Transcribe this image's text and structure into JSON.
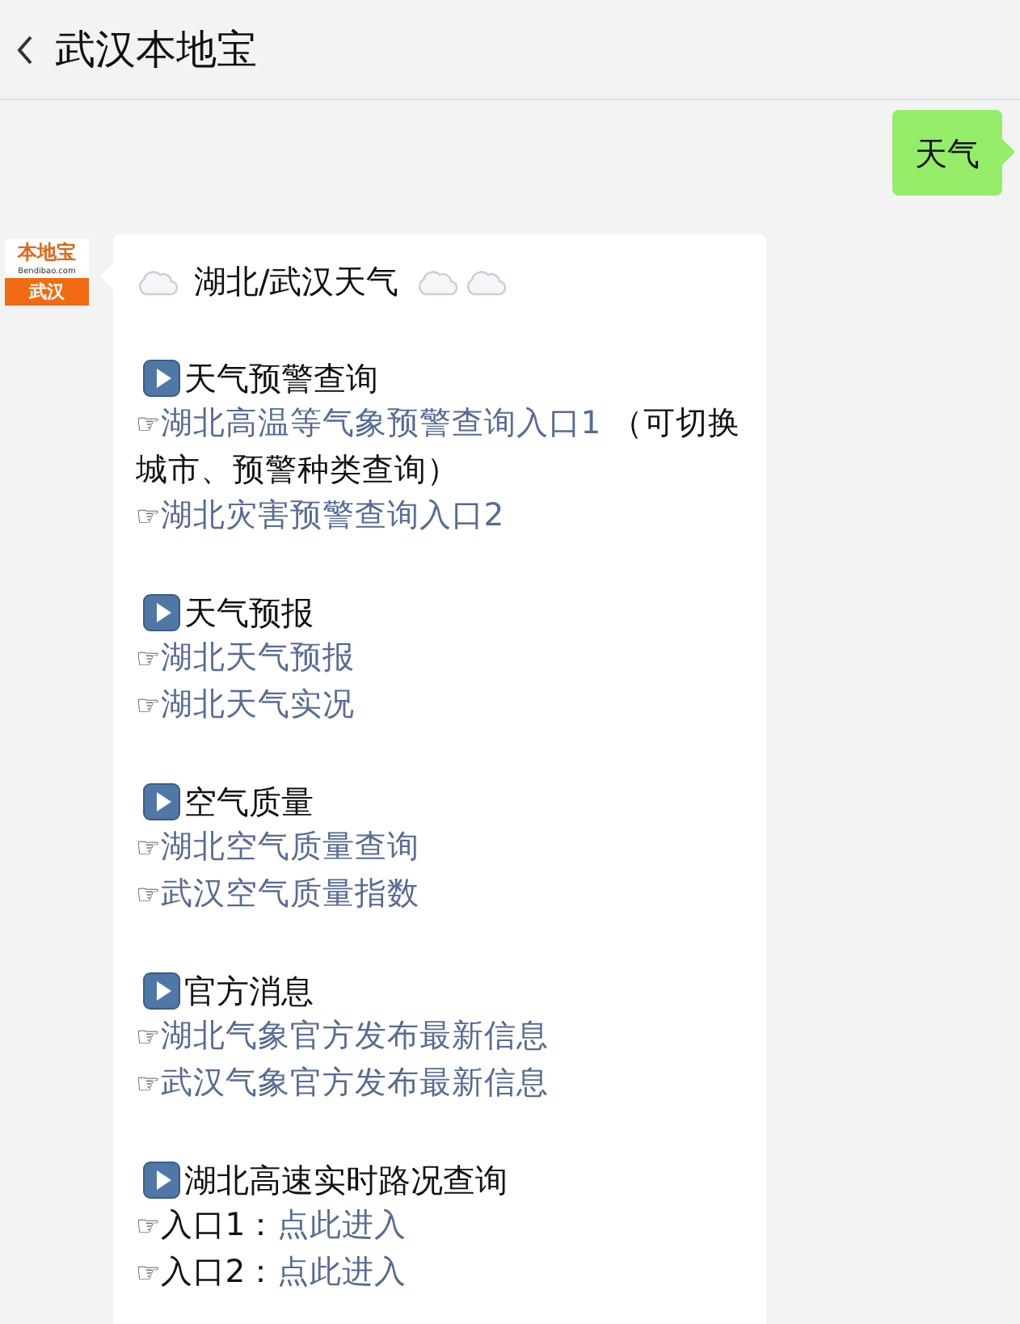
{
  "header": {
    "title": "武汉本地宝"
  },
  "messages": [
    {
      "kind": "sent",
      "text": "天气"
    },
    {
      "kind": "received",
      "avatar": {
        "brand": "本地宝",
        "domain": "Bendibao.com",
        "city": "武汉"
      },
      "title": "湖北/武汉天气",
      "sections": [
        {
          "heading": "天气预警查询",
          "lines": [
            {
              "hand": "☞",
              "parts": [
                {
                  "text": "湖北高温等气象预警查询入口1",
                  "link": true
                },
                {
                  "text": " （可切换城市、预警种类查询）",
                  "link": false
                }
              ]
            },
            {
              "hand": "☞",
              "parts": [
                {
                  "text": "湖北灾害预警查询入口2",
                  "link": true
                }
              ]
            }
          ]
        },
        {
          "heading": "天气预报",
          "lines": [
            {
              "hand": "☞",
              "parts": [
                {
                  "text": "湖北天气预报",
                  "link": true
                }
              ]
            },
            {
              "hand": "☞",
              "parts": [
                {
                  "text": "湖北天气实况",
                  "link": true
                }
              ]
            }
          ]
        },
        {
          "heading": "空气质量",
          "lines": [
            {
              "hand": "☞",
              "parts": [
                {
                  "text": "湖北空气质量查询",
                  "link": true
                }
              ]
            },
            {
              "hand": "☞",
              "parts": [
                {
                  "text": "武汉空气质量指数",
                  "link": true
                }
              ]
            }
          ]
        },
        {
          "heading": "官方消息",
          "lines": [
            {
              "hand": "☞",
              "parts": [
                {
                  "text": "湖北气象官方发布最新信息",
                  "link": true
                }
              ]
            },
            {
              "hand": "☞",
              "parts": [
                {
                  "text": "武汉气象官方发布最新信息",
                  "link": true
                }
              ]
            }
          ]
        },
        {
          "heading": "湖北高速实时路况查询",
          "lines": [
            {
              "hand": "☞",
              "parts": [
                {
                  "text": "入口1：",
                  "link": false
                },
                {
                  "text": "点此进入",
                  "link": true
                }
              ]
            },
            {
              "hand": "☞",
              "parts": [
                {
                  "text": "入口2：",
                  "link": false
                },
                {
                  "text": "点此进入",
                  "link": true
                }
              ]
            }
          ]
        }
      ]
    }
  ]
}
